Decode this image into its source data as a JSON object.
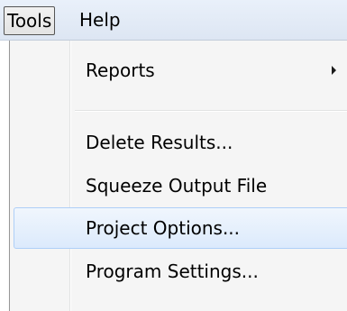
{
  "menubar": {
    "tools_label": "Tools",
    "help_label": "Help"
  },
  "tools_menu": {
    "items": [
      {
        "label": "Reports",
        "has_submenu": true
      },
      {
        "label": "Delete Results..."
      },
      {
        "label": "Squeeze Output File"
      },
      {
        "label": "Project Options...",
        "highlighted": true
      },
      {
        "label": "Program Settings..."
      }
    ],
    "submenu_icon": "chevron-right-icon"
  },
  "colors": {
    "menubar_bg": "#dde6f3",
    "menu_bg": "#f5f5f5",
    "highlight_border": "#aecff7",
    "highlight_bg": "#dceafc"
  }
}
